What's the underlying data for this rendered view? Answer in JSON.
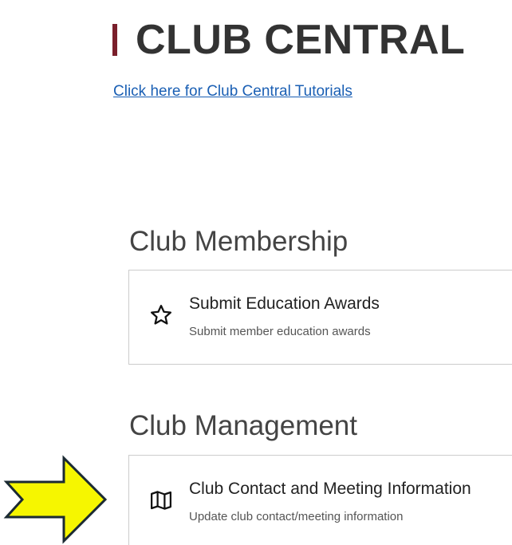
{
  "header": {
    "title": "CLUB CENTRAL",
    "tutorial_link": "Click here for Club Central Tutorials"
  },
  "sections": [
    {
      "heading": "Club Membership",
      "card": {
        "icon": "star-icon",
        "title": "Submit Education Awards",
        "description": "Submit member education awards"
      }
    },
    {
      "heading": "Club Management",
      "card": {
        "icon": "map-icon",
        "title": "Club Contact and Meeting Information",
        "description": "Update club contact/meeting information"
      }
    }
  ],
  "annotation": {
    "icon": "arrow-right-icon",
    "fill_color": "#f6f600",
    "stroke_color": "#1b2a33"
  },
  "colors": {
    "accent": "#7a1f2b",
    "link": "#1a5fb4",
    "text": "#333333"
  }
}
